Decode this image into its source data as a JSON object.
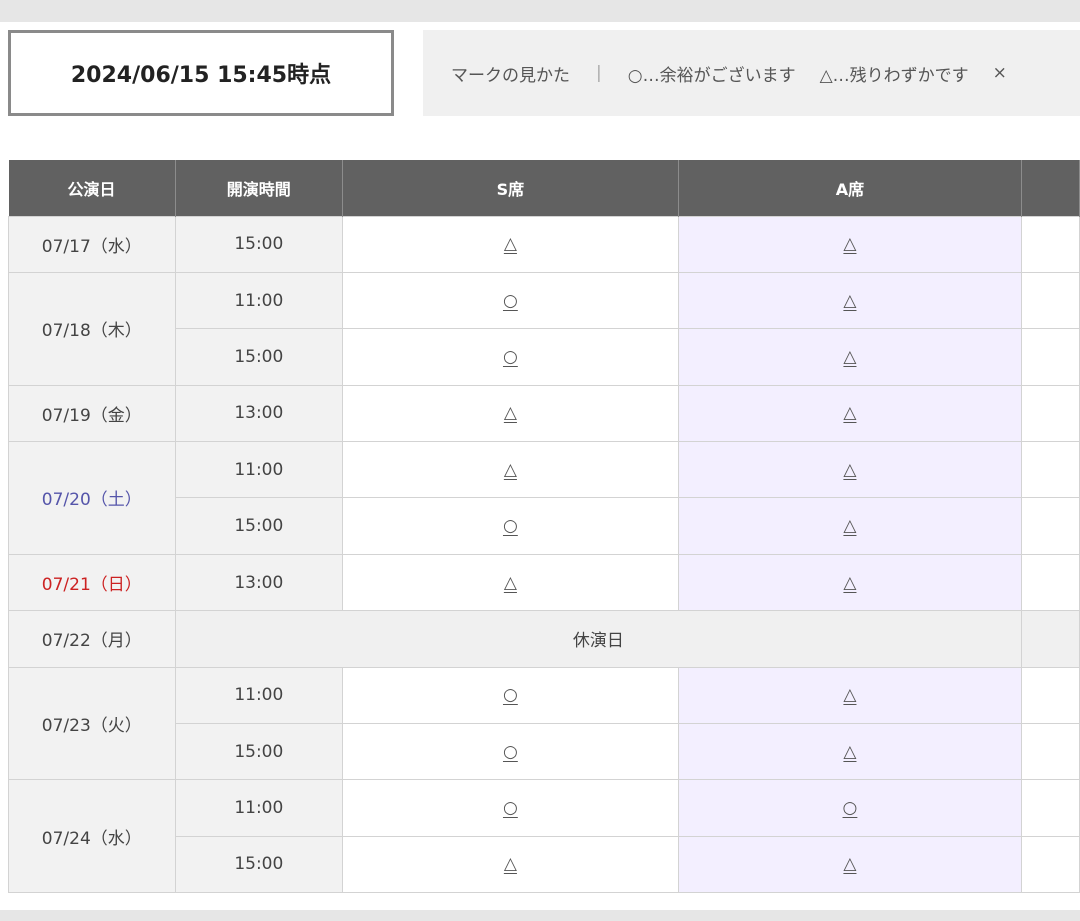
{
  "header": {
    "timestamp": "2024/06/15 15:45時点",
    "legend": {
      "title": "マークの見かた",
      "separator": "|",
      "items": [
        "○…余裕がございます",
        "△…残りわずかです",
        "×"
      ]
    }
  },
  "table": {
    "columns": [
      "公演日",
      "開演時間",
      "S席",
      "A席",
      ""
    ],
    "rows": [
      {
        "date": "07/17（水）",
        "time": "15:00",
        "s": "△",
        "a": "△"
      },
      {
        "date": "07/18（木）",
        "time": "11:00",
        "s": "○",
        "a": "△"
      },
      {
        "date": "",
        "time": "15:00",
        "s": "○",
        "a": "△"
      },
      {
        "date": "07/19（金）",
        "time": "13:00",
        "s": "△",
        "a": "△"
      },
      {
        "date": "07/20（土）",
        "time": "11:00",
        "s": "△",
        "a": "△"
      },
      {
        "date": "",
        "time": "15:00",
        "s": "○",
        "a": "△"
      },
      {
        "date": "07/21（日）",
        "time": "13:00",
        "s": "△",
        "a": "△"
      },
      {
        "date": "07/22（月）",
        "closed": "休演日"
      },
      {
        "date": "07/23（火）",
        "time": "11:00",
        "s": "○",
        "a": "△"
      },
      {
        "date": "",
        "time": "15:00",
        "s": "○",
        "a": "△"
      },
      {
        "date": "07/24（水）",
        "time": "11:00",
        "s": "○",
        "a": "○"
      },
      {
        "date": "",
        "time": "15:00",
        "s": "△",
        "a": "△"
      }
    ]
  },
  "colors": {
    "header_bg": "#616161",
    "a_column_bg": "#f3efff",
    "saturday": "#5555aa",
    "sunday": "#cc2222"
  }
}
